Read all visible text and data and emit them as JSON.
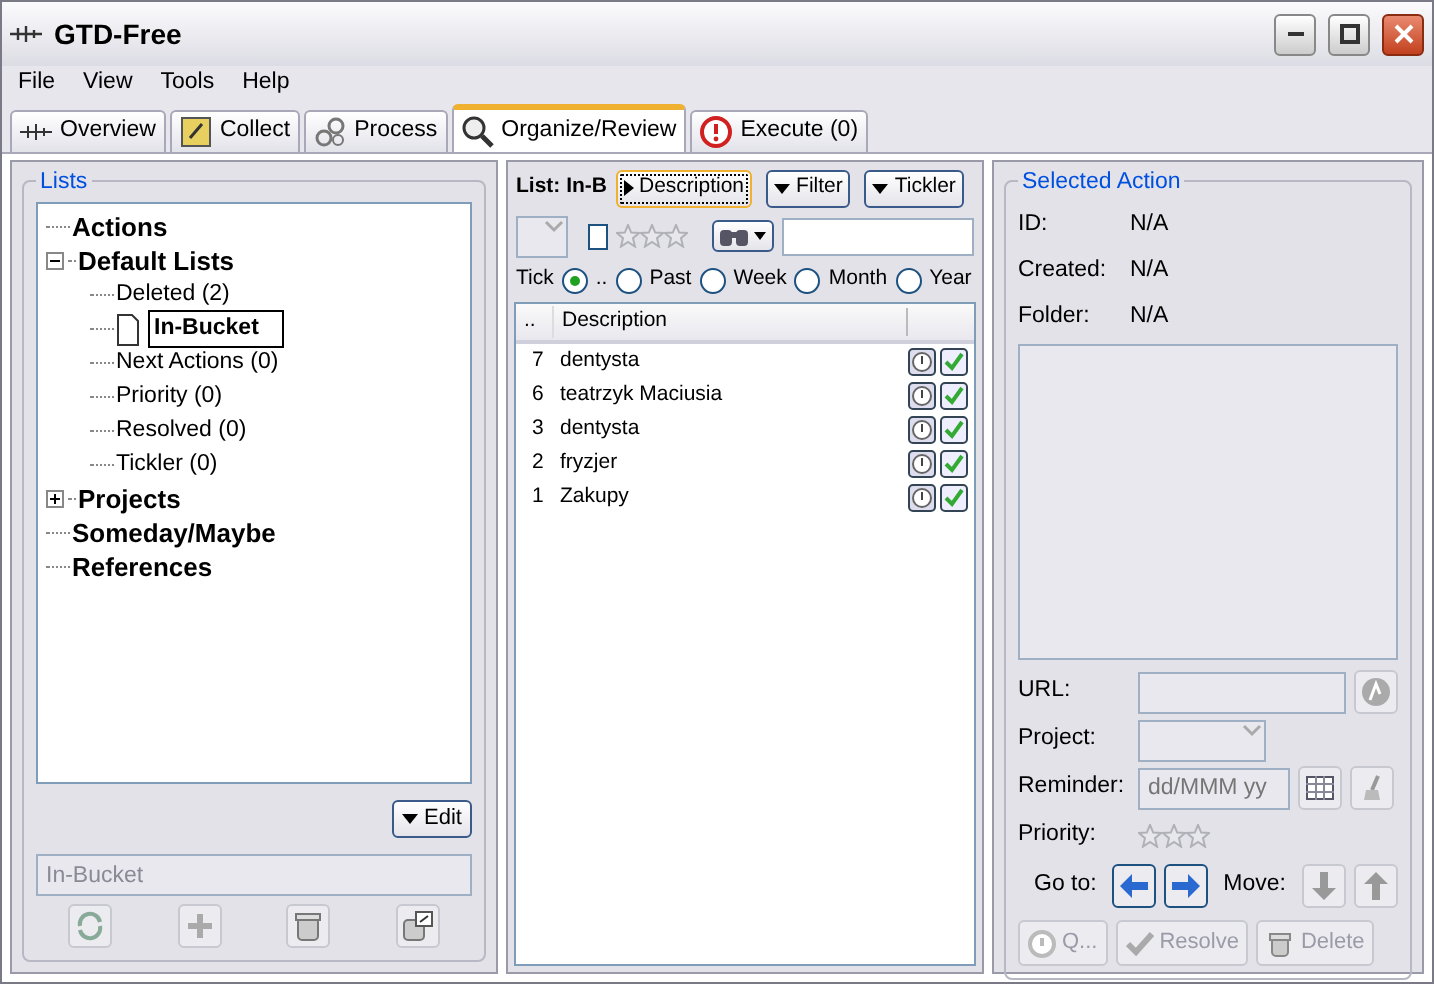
{
  "window": {
    "title": "GTD-Free"
  },
  "menu": [
    "File",
    "View",
    "Tools",
    "Help"
  ],
  "tabs": [
    {
      "label": "Overview",
      "kind": "overview",
      "selected": false
    },
    {
      "label": "Collect",
      "kind": "collect",
      "selected": false
    },
    {
      "label": "Process",
      "kind": "process",
      "selected": false
    },
    {
      "label": "Organize/Review",
      "kind": "organize",
      "selected": true
    },
    {
      "label": "Execute (0)",
      "kind": "execute",
      "selected": false
    }
  ],
  "lists_panel": {
    "title": "Lists",
    "tree": [
      {
        "label": "Actions",
        "selected": false
      },
      {
        "label": "Default Lists",
        "selected": false,
        "expanded": true,
        "children": [
          {
            "label": "Deleted (2)",
            "selected": false
          },
          {
            "label": "In-Bucket",
            "selected": true
          },
          {
            "label": "Next Actions (0)",
            "selected": false
          },
          {
            "label": "Priority (0)",
            "selected": false
          },
          {
            "label": "Resolved (0)",
            "selected": false
          },
          {
            "label": "Tickler (0)",
            "selected": false
          }
        ]
      },
      {
        "label": "Projects",
        "selected": false,
        "expanded": false
      },
      {
        "label": "Someday/Maybe",
        "selected": false
      },
      {
        "label": "References",
        "selected": false
      }
    ],
    "edit_button": "Edit",
    "name_field": {
      "value": "In-Bucket"
    }
  },
  "actions_panel": {
    "list_label": "List: In-B",
    "toggles": [
      {
        "label": "Description",
        "kind": "expand",
        "focused": true
      },
      {
        "label": "Filter",
        "kind": "menu",
        "focused": false
      },
      {
        "label": "Tickler",
        "kind": "menu",
        "focused": false
      }
    ],
    "filter": {
      "checked": false,
      "stars": 0
    },
    "tickler_label": "Tick",
    "tickler_options": [
      {
        "label": "..",
        "selected": true
      },
      {
        "label": "Past",
        "selected": false
      },
      {
        "label": "Week",
        "selected": false
      },
      {
        "label": "Month",
        "selected": false
      },
      {
        "label": "Year",
        "selected": false
      }
    ],
    "table": {
      "columns": [
        "..",
        "Description"
      ],
      "rows": [
        {
          "id": "7",
          "description": "dentysta"
        },
        {
          "id": "6",
          "description": "teatrzyk Maciusia"
        },
        {
          "id": "3",
          "description": "dentysta"
        },
        {
          "id": "2",
          "description": "fryzjer"
        },
        {
          "id": "1",
          "description": "Zakupy"
        }
      ]
    }
  },
  "selected_action": {
    "title": "Selected Action",
    "info": [
      {
        "label": "ID:",
        "value": "N/A"
      },
      {
        "label": "Created:",
        "value": "N/A"
      },
      {
        "label": "Folder:",
        "value": "N/A"
      }
    ],
    "url_label": "URL:",
    "project_label": "Project:",
    "reminder_label": "Reminder:",
    "reminder_placeholder": "dd/MMM yy",
    "priority": {
      "label": "Priority:",
      "stars": 0
    },
    "goto_label": "Go to:",
    "move_label": "Move:",
    "buttons": [
      {
        "label": "Q...",
        "kind": "queue",
        "disabled": true
      },
      {
        "label": "Resolve",
        "kind": "resolve",
        "disabled": true
      },
      {
        "label": "Delete",
        "kind": "delete",
        "disabled": true
      }
    ]
  }
}
